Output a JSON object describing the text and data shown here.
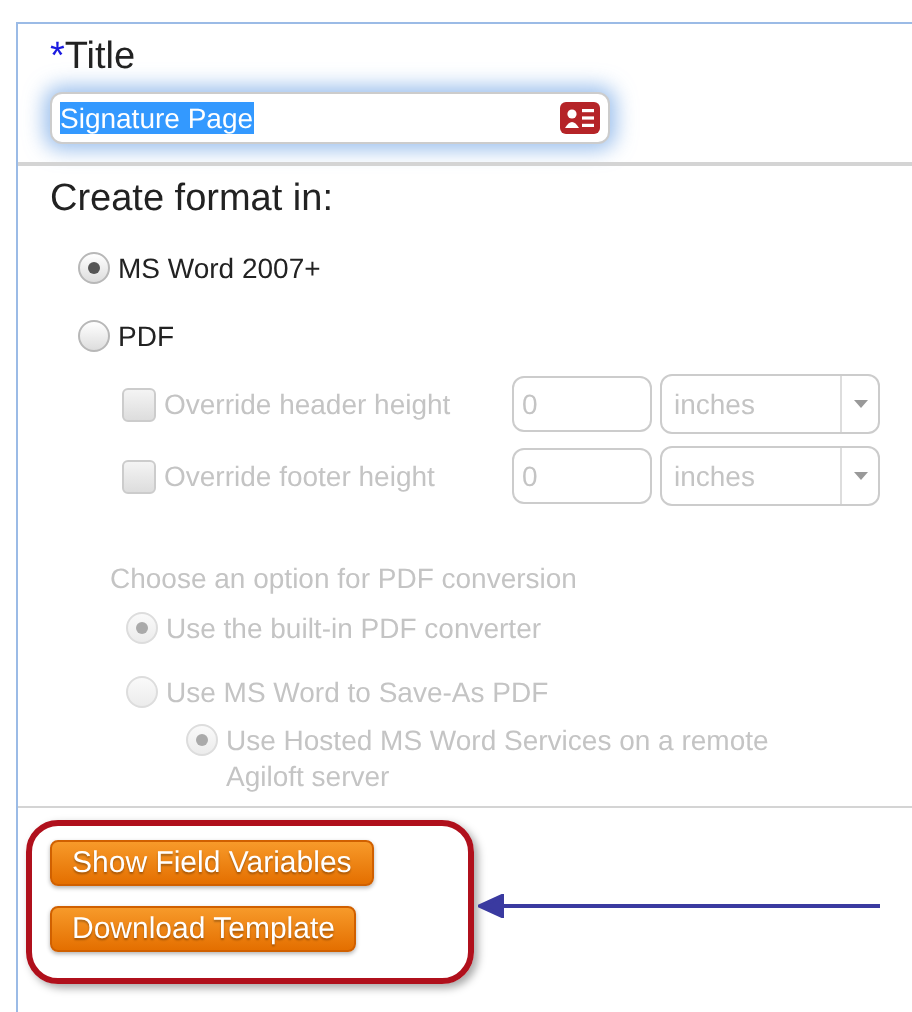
{
  "title_field": {
    "required_mark": "*",
    "label": "Title",
    "value": "Signature Page",
    "text_selected": true
  },
  "format": {
    "heading": "Create format in:",
    "options": [
      {
        "label": "MS Word 2007+",
        "selected": true
      },
      {
        "label": "PDF",
        "selected": false
      }
    ]
  },
  "pdf_settings": {
    "disabled": true,
    "overrides": [
      {
        "label": "Override header height",
        "checked": false,
        "value": "0",
        "unit": "inches"
      },
      {
        "label": "Override footer height",
        "checked": false,
        "value": "0",
        "unit": "inches"
      }
    ],
    "conversion_heading": "Choose an option for PDF conversion",
    "conversion_options": [
      {
        "label": "Use the built-in PDF converter",
        "selected": true
      },
      {
        "label": "Use MS Word to Save-As PDF",
        "selected": false,
        "children": [
          {
            "label": "Use Hosted MS Word Services on a remote Agiloft server",
            "selected": true
          }
        ]
      }
    ]
  },
  "buttons": [
    "Show Field Variables",
    "Download Template"
  ]
}
